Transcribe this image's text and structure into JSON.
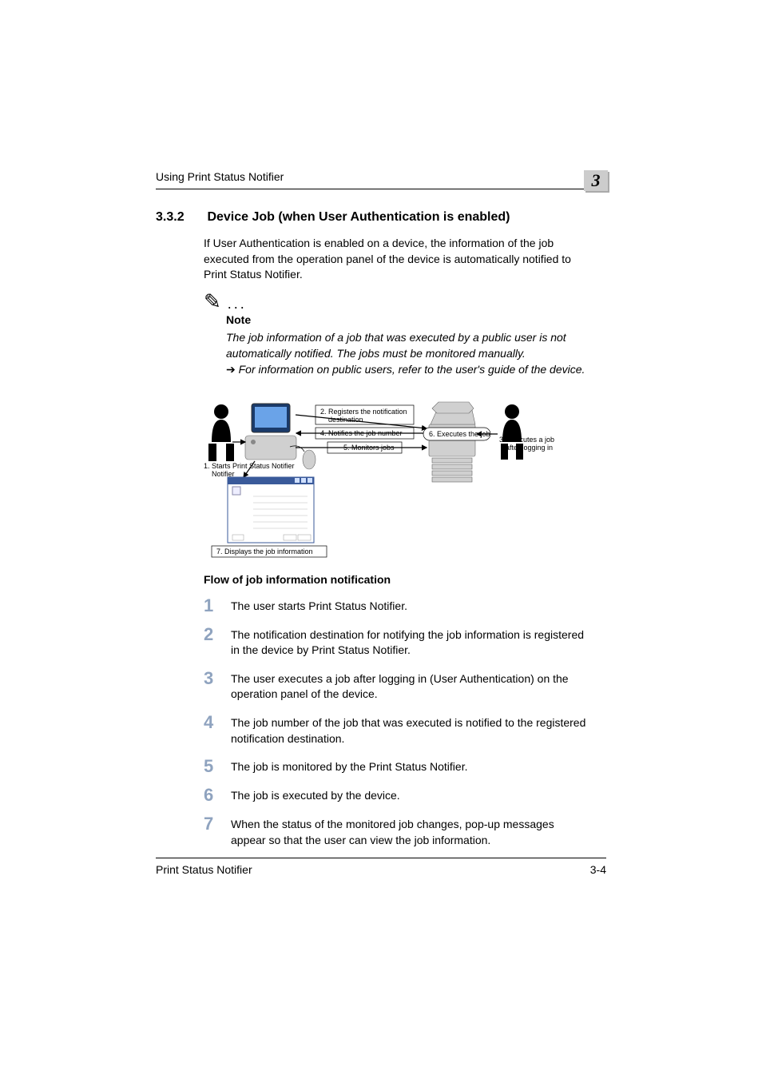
{
  "header": {
    "running_title": "Using Print Status Notifier",
    "chapter_number": "3"
  },
  "section": {
    "number": "3.3.2",
    "title": "Device Job (when User Authentication is enabled)",
    "intro": "If User Authentication is enabled on a device, the information of the job executed from the operation panel of the device is automatically notified to Print Status Notifier."
  },
  "note": {
    "label": "Note",
    "body": "The job information of a job that was executed by a public user is not automatically notified. The jobs must be monitored manually.",
    "ref": "For information on public users, refer to the user's guide of the device."
  },
  "diagram": {
    "label1": "1. Starts Print Status Notifier",
    "box2a": "2. Registers the notification",
    "box2b": "destination",
    "box4": "4. Notifies the job number",
    "box5": "5. Monitors jobs",
    "box6": "6. Executes the job",
    "label3a": "3. Executes a job",
    "label3b": "after logging in",
    "label7": "7. Displays the job information"
  },
  "flow": {
    "heading": "Flow of job information notification",
    "steps": [
      "The user starts Print Status Notifier.",
      "The notification destination for notifying the job information is registered in the device by Print Status Notifier.",
      "The user executes a job after logging in (User Authentication) on the operation panel of the device.",
      "The job number of the job that was executed is notified to the registered notification destination.",
      "The job is monitored by the Print Status Notifier.",
      "The job is executed by the device.",
      "When the status of the monitored job changes, pop-up messages appear so that the user can view the job information."
    ]
  },
  "footer": {
    "doc_title": "Print Status Notifier",
    "page_number": "3-4"
  }
}
